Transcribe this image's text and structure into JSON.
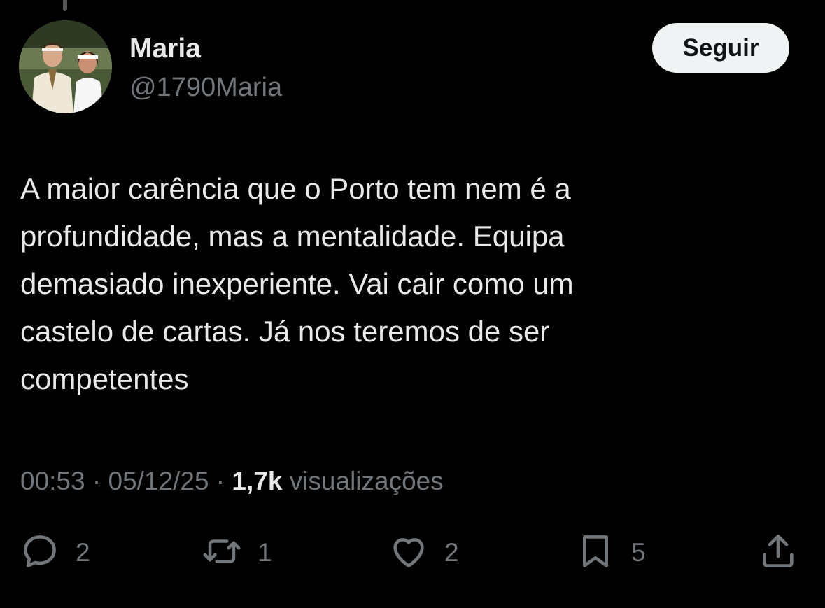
{
  "author": {
    "display_name": "Maria",
    "handle": "@1790Maria"
  },
  "follow_button": {
    "label": "Seguir"
  },
  "tweet": {
    "text": "A maior carência que o Porto tem nem é a\nprofundidade, mas a mentalidade. Equipa\ndemasiado inexperiente. Vai cair como um\ncastelo de cartas. Já nos teremos de ser\ncompetentes"
  },
  "meta": {
    "time": "00:53",
    "separator": " · ",
    "date": "05/12/25",
    "views_count": "1,7k",
    "views_label": " visualizações"
  },
  "actions": {
    "reply": {
      "icon": "reply-icon",
      "count": "2"
    },
    "retweet": {
      "icon": "retweet-icon",
      "count": "1"
    },
    "like": {
      "icon": "heart-icon",
      "count": "2"
    },
    "bookmark": {
      "icon": "bookmark-icon",
      "count": "5"
    },
    "share": {
      "icon": "share-icon"
    }
  },
  "colors": {
    "background": "#000000",
    "primary_text": "#e7e9ea",
    "secondary_text": "#71767b",
    "follow_button_bg": "#eff3f4"
  }
}
